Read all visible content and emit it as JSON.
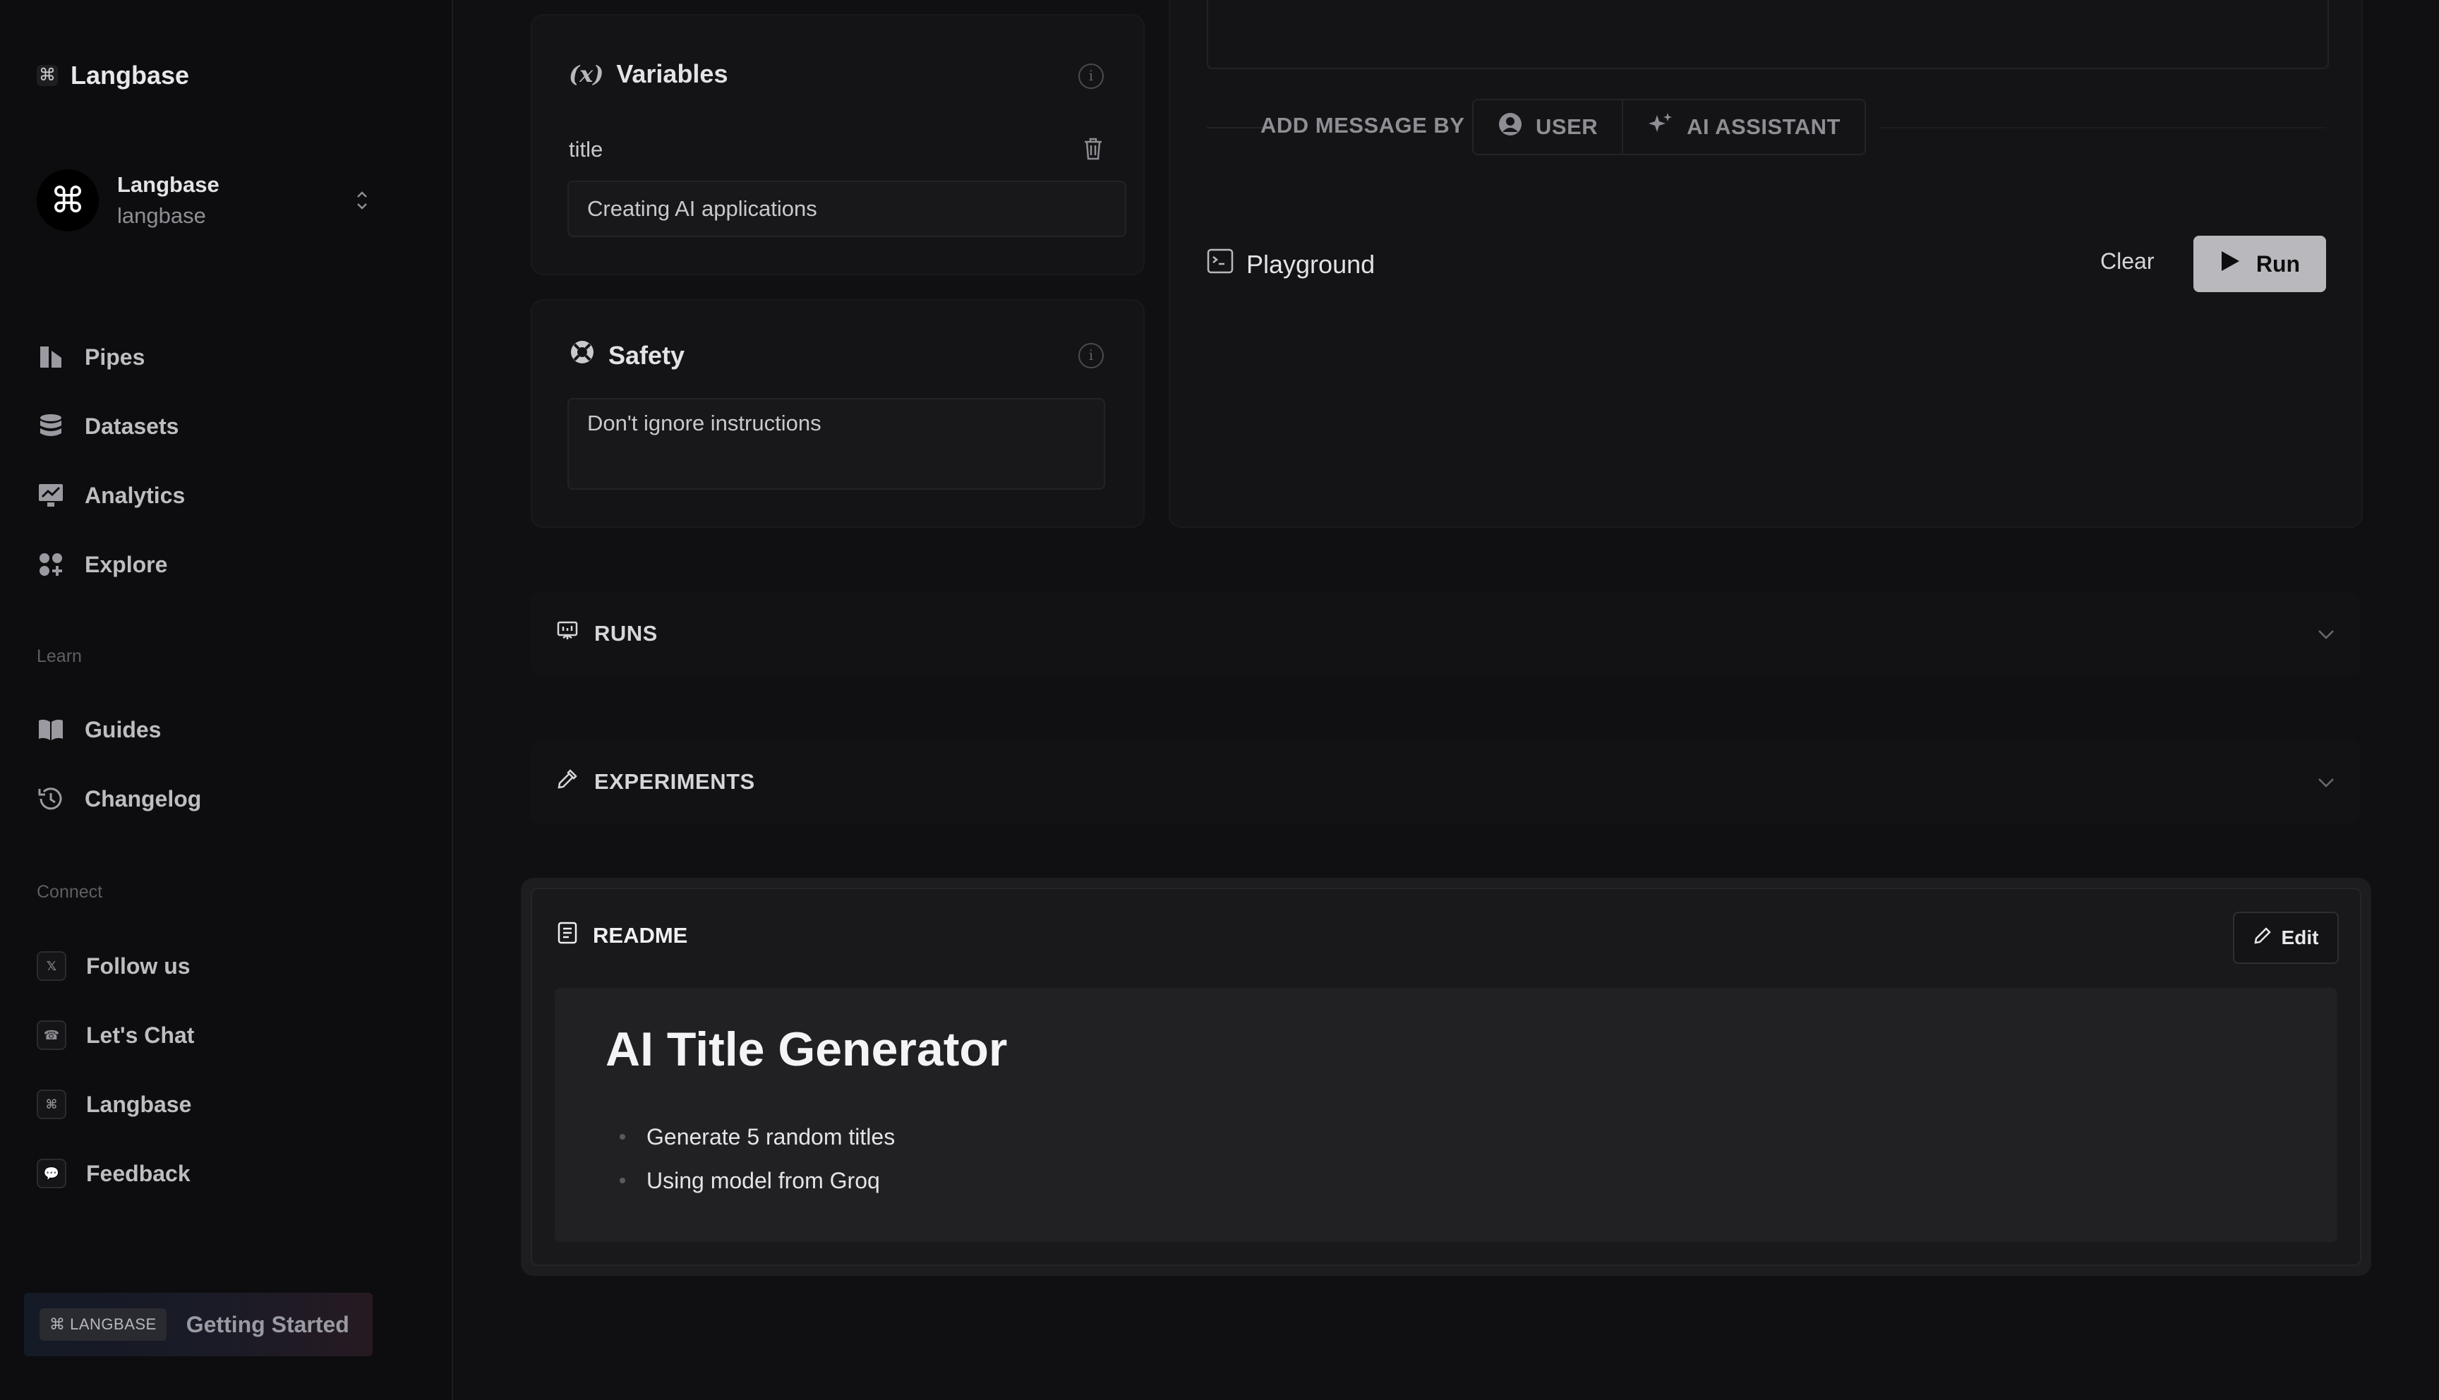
{
  "sidebar": {
    "brand": "Langbase",
    "org": {
      "name": "Langbase",
      "handle": "langbase"
    },
    "nav": [
      {
        "label": "Pipes",
        "icon": "pipes-icon"
      },
      {
        "label": "Datasets",
        "icon": "database-icon"
      },
      {
        "label": "Analytics",
        "icon": "chart-icon"
      },
      {
        "label": "Explore",
        "icon": "grid-icon"
      }
    ],
    "learn_label": "Learn",
    "learn": [
      {
        "label": "Guides",
        "icon": "book-icon"
      },
      {
        "label": "Changelog",
        "icon": "history-icon"
      }
    ],
    "connect_label": "Connect",
    "connect": [
      {
        "label": "Follow us",
        "icon": "x-icon"
      },
      {
        "label": "Let's Chat",
        "icon": "discord-icon"
      },
      {
        "label": "Langbase",
        "icon": "command-icon"
      },
      {
        "label": "Feedback",
        "icon": "chat-bubble-icon"
      }
    ],
    "getting_started": {
      "badge": "⌘ LANGBASE",
      "label": "Getting Started"
    }
  },
  "variables": {
    "title": "Variables",
    "field_label": "title",
    "field_value": "Creating AI applications"
  },
  "safety": {
    "title": "Safety",
    "value": "Don't ignore instructions"
  },
  "messages": {
    "add_by_label": "ADD MESSAGE BY",
    "user_label": "USER",
    "assistant_label": "AI ASSISTANT"
  },
  "playground": {
    "title": "Playground",
    "clear_label": "Clear",
    "run_label": "Run"
  },
  "runs": {
    "label": "RUNS"
  },
  "experiments": {
    "label": "EXPERIMENTS"
  },
  "readme": {
    "label": "README",
    "edit_label": "Edit",
    "heading": "AI Title Generator",
    "items": [
      "Generate 5 random titles",
      "Using model from Groq"
    ]
  }
}
